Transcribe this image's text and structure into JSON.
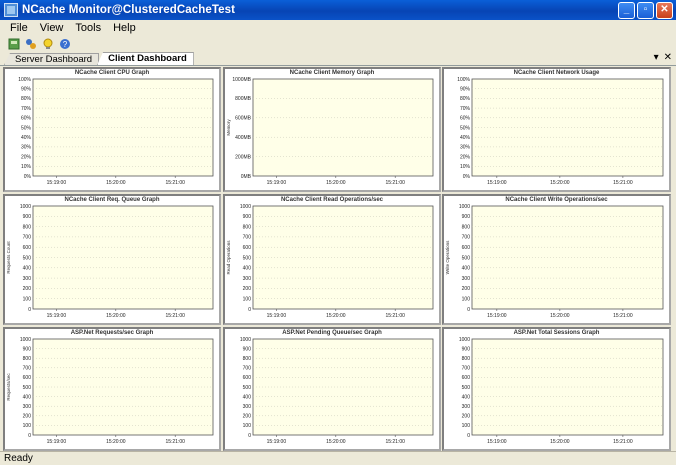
{
  "window": {
    "title": "NCache Monitor@ClusteredCacheTest"
  },
  "menu": [
    "File",
    "View",
    "Tools",
    "Help"
  ],
  "toolbar": {
    "icons": [
      "connect-icon",
      "cluster-icon",
      "lightbulb-icon",
      "help-icon"
    ]
  },
  "tabs": [
    {
      "label": "Server Dashboard",
      "active": false
    },
    {
      "label": "Client Dashboard",
      "active": true
    }
  ],
  "tab_controls": {
    "dropdown": "▾",
    "close": "✕"
  },
  "x_ticks": [
    "15:19:00",
    "15:20:00",
    "15:21:00"
  ],
  "panels": [
    {
      "title": "NCache Client CPU Graph",
      "ylabel": "",
      "yticks": [
        "100%",
        "90%",
        "80%",
        "70%",
        "60%",
        "50%",
        "40%",
        "30%",
        "20%",
        "10%",
        "0%"
      ]
    },
    {
      "title": "NCache Client Memory Graph",
      "ylabel": "Memory",
      "yticks": [
        "1000MB",
        "800MB",
        "600MB",
        "400MB",
        "200MB",
        "0MB"
      ]
    },
    {
      "title": "NCache Client Network Usage",
      "ylabel": "",
      "yticks": [
        "100%",
        "90%",
        "80%",
        "70%",
        "60%",
        "50%",
        "40%",
        "30%",
        "20%",
        "10%",
        "0%"
      ]
    },
    {
      "title": "NCache Client Req. Queue Graph",
      "ylabel": "Requests Count",
      "yticks": [
        "1000",
        "900",
        "800",
        "700",
        "600",
        "500",
        "400",
        "300",
        "200",
        "100",
        "0"
      ]
    },
    {
      "title": "NCache Client Read Operations/sec",
      "ylabel": "Read Operations",
      "yticks": [
        "1000",
        "900",
        "800",
        "700",
        "600",
        "500",
        "400",
        "300",
        "200",
        "100",
        "0"
      ]
    },
    {
      "title": "NCache Client Write Operations/sec",
      "ylabel": "Write Operations",
      "yticks": [
        "1000",
        "900",
        "800",
        "700",
        "600",
        "500",
        "400",
        "300",
        "200",
        "100",
        "0"
      ]
    },
    {
      "title": "ASP.Net Requests/sec Graph",
      "ylabel": "Requests/sec",
      "yticks": [
        "1000",
        "900",
        "800",
        "700",
        "600",
        "500",
        "400",
        "300",
        "200",
        "100",
        "0"
      ]
    },
    {
      "title": "ASP.Net Pending Queue/sec Graph",
      "ylabel": "",
      "yticks": [
        "1000",
        "900",
        "800",
        "700",
        "600",
        "500",
        "400",
        "300",
        "200",
        "100",
        "0"
      ]
    },
    {
      "title": "ASP.Net Total Sessions Graph",
      "ylabel": "",
      "yticks": [
        "1000",
        "900",
        "800",
        "700",
        "600",
        "500",
        "400",
        "300",
        "200",
        "100",
        "0"
      ]
    }
  ],
  "status": {
    "text": "Ready"
  },
  "colors": {
    "plot_bg": "#ffffe8",
    "titlebar": "#0a52c8"
  }
}
